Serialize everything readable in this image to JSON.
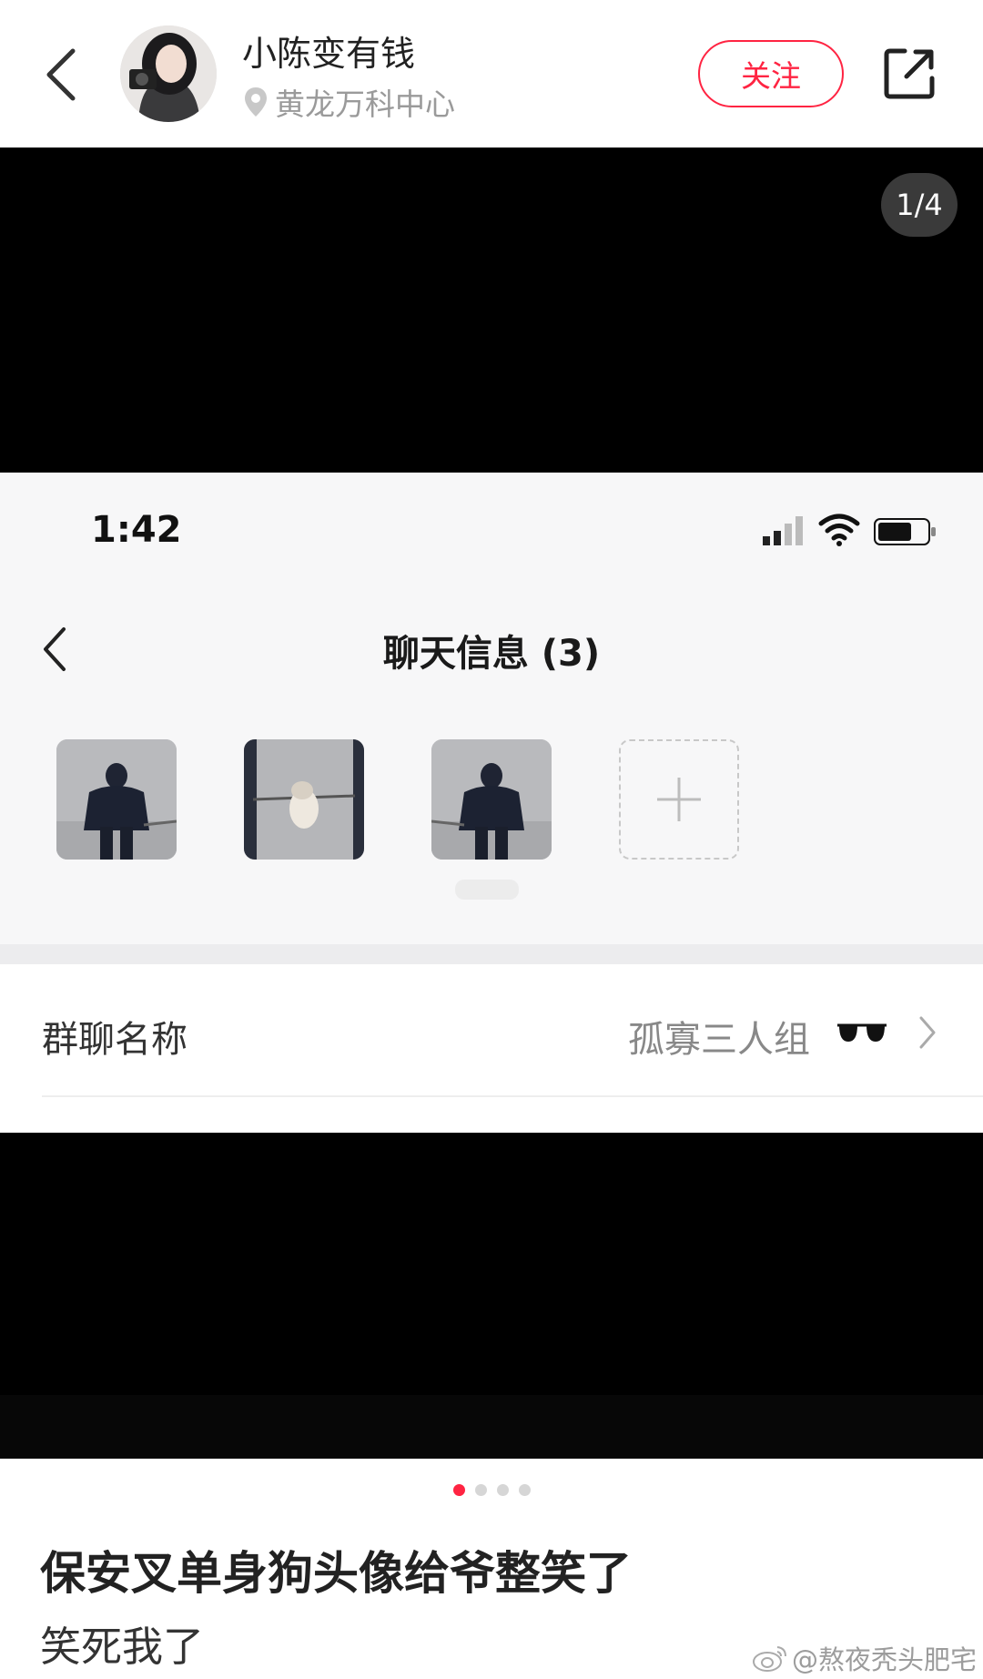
{
  "header": {
    "author_name": "小陈变有钱",
    "location": "黄龙万科中心",
    "follow_label": "关注"
  },
  "media": {
    "page_counter": "1/4",
    "current_page": 1,
    "total_pages": 4,
    "screenshot": {
      "status_time": "1:42",
      "title": "聊天信息 (3)",
      "group_name_label": "群聊名称",
      "group_name_value": "孤寡三人组",
      "group_name_emoji": "sunglasses-icon"
    }
  },
  "post": {
    "title": "保安叉单身狗头像给爷整笑了",
    "body": "笑死我了"
  },
  "watermark": "@熬夜秃头肥宅",
  "colors": {
    "accent": "#ff2442",
    "media_bg": "#000000"
  }
}
